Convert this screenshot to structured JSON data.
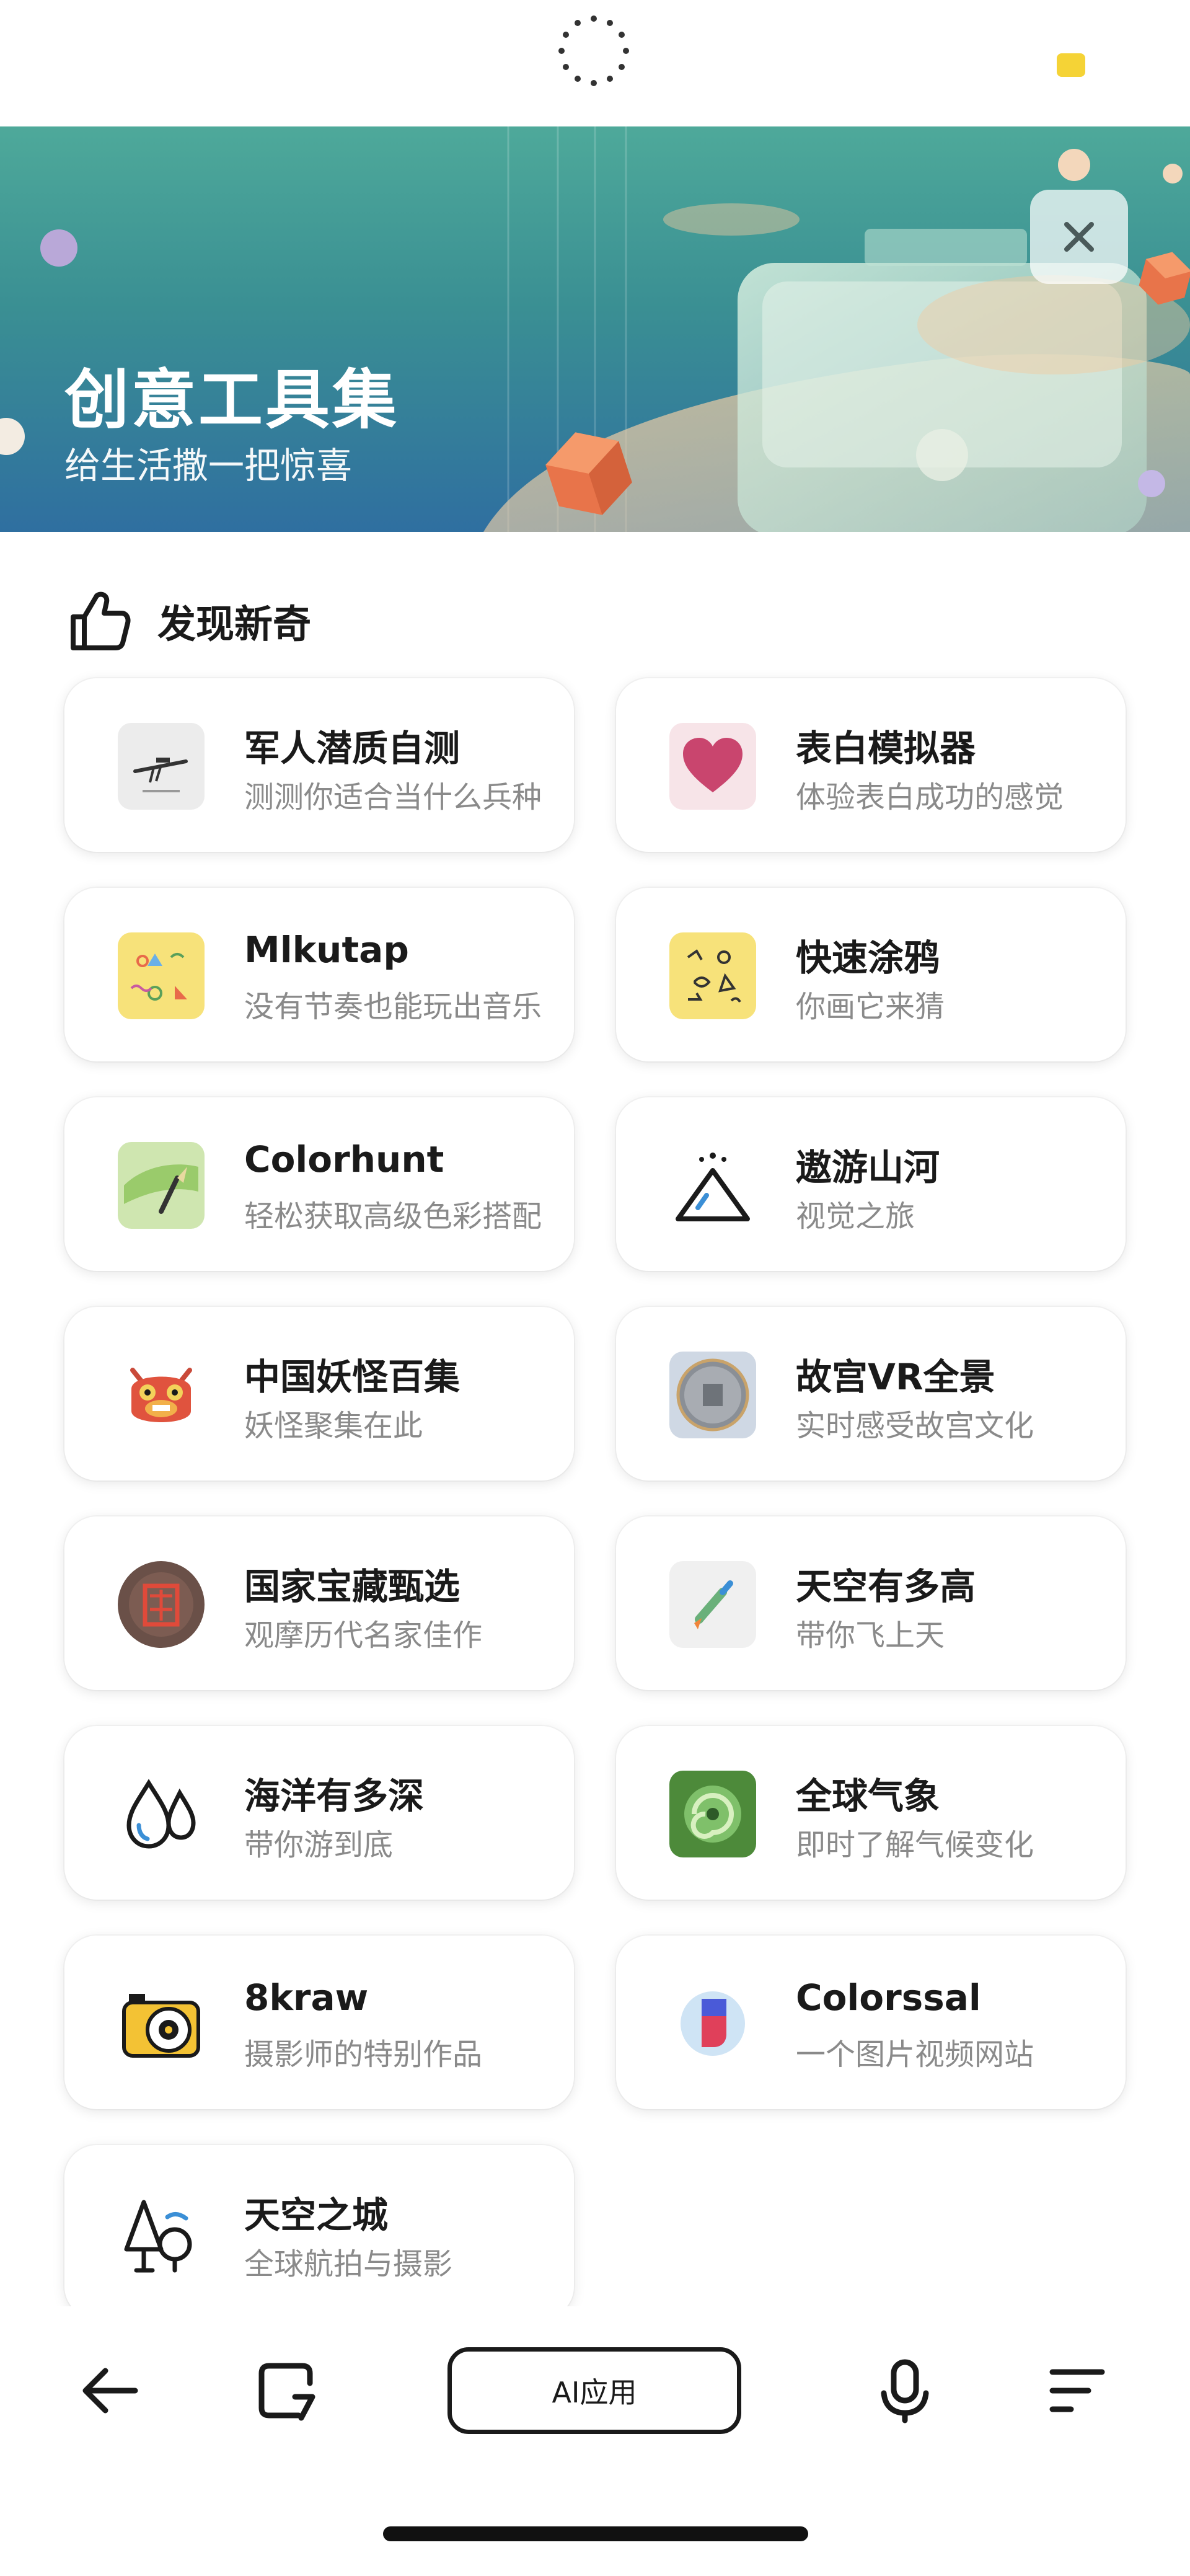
{
  "status_bar": {
    "loading_icon": "spinner-icon",
    "indicator_color": "#f5d336"
  },
  "banner": {
    "title": "创意工具集",
    "subtitle": "给生活撒一把惊喜",
    "close_icon": "close-icon"
  },
  "section": {
    "icon": "thumbs-up-icon",
    "title": "发现新奇"
  },
  "apps": [
    {
      "title": "军人潜质自测",
      "desc": "测测你适合当什么兵种",
      "icon": "sniper-rifle-icon"
    },
    {
      "title": "表白模拟器",
      "desc": "体验表白成功的感觉",
      "icon": "heart-icon"
    },
    {
      "title": "Mlkutap",
      "desc": "没有节奏也能玩出音乐",
      "icon": "doodle-shapes-icon"
    },
    {
      "title": "快速涂鸦",
      "desc": "你画它来猜",
      "icon": "doodle-sketch-icon"
    },
    {
      "title": "Colorhunt",
      "desc": "轻松获取高级色彩搭配",
      "icon": "paint-brush-icon"
    },
    {
      "title": "遨游山河",
      "desc": "视觉之旅",
      "icon": "mountain-icon"
    },
    {
      "title": "中国妖怪百集",
      "desc": "妖怪聚集在此",
      "icon": "monster-mask-icon"
    },
    {
      "title": "故宫VR全景",
      "desc": "实时感受故宫文化",
      "icon": "palace-seal-icon"
    },
    {
      "title": "国家宝藏甄选",
      "desc": "观摩历代名家佳作",
      "icon": "treasure-seal-icon"
    },
    {
      "title": "天空有多高",
      "desc": "带你飞上天",
      "icon": "rocket-icon"
    },
    {
      "title": "海洋有多深",
      "desc": "带你游到底",
      "icon": "water-drops-icon"
    },
    {
      "title": "全球气象",
      "desc": "即时了解气候变化",
      "icon": "weather-swirl-icon"
    },
    {
      "title": "8kraw",
      "desc": "摄影师的特别作品",
      "icon": "camera-icon"
    },
    {
      "title": "Colorssal",
      "desc": "一个图片视频网站",
      "icon": "colorssal-logo-icon"
    },
    {
      "title": "天空之城",
      "desc": "全球航拍与摄影",
      "icon": "tree-city-icon"
    }
  ],
  "bottom_nav": {
    "back_icon": "back-arrow-icon",
    "tabs_icon": "tabs-icon",
    "ai_label": "AI应用",
    "mic_icon": "microphone-icon",
    "menu_icon": "menu-icon"
  },
  "colors": {
    "banner_top": "#4ea99a",
    "banner_bottom": "#2f6fa0",
    "card_bg": "#ffffff",
    "desc_text": "#8a8a8a"
  }
}
